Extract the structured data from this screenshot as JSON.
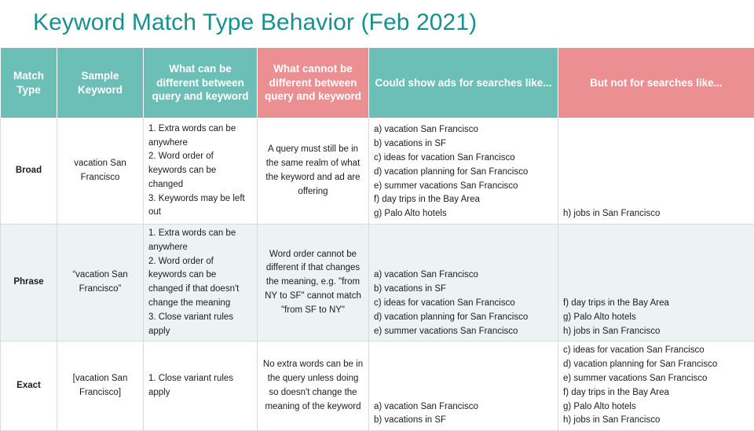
{
  "slide": {
    "title": "Keyword Match Type Behavior (Feb 2021)",
    "title_color": "#17918f",
    "background_color": "#ffffff"
  },
  "table": {
    "header_teal_color": "#6cbfb6",
    "header_salmon_color": "#eb8f92",
    "alt_row_color": "#ecf3f2",
    "columns": [
      {
        "label": "Match Type",
        "style": "teal"
      },
      {
        "label": "Sample Keyword",
        "style": "teal"
      },
      {
        "label": "What can be different between query and keyword",
        "style": "teal"
      },
      {
        "label": "What cannot be different between query and keyword",
        "style": "salmon"
      },
      {
        "label": "Could show ads for searches like...",
        "style": "teal"
      },
      {
        "label": "But not for searches like...",
        "style": "salmon"
      }
    ],
    "rows": [
      {
        "match_type": "Broad",
        "sample_keyword": "vacation San Francisco",
        "can_be_different": [
          "1. Extra words can be anywhere",
          "2. Word order of keywords can be changed",
          "3. Keywords may be left out"
        ],
        "cannot_be_different": [
          "A query must still be in the same realm of what the keyword and ad are offering"
        ],
        "could_show": [
          "a) vacation San Francisco",
          "b) vacations in SF",
          "c) ideas for vacation San Francisco",
          "d) vacation planning for San Francisco",
          "e) summer vacations San Francisco",
          "f) day trips in the Bay Area",
          "g) Palo Alto hotels"
        ],
        "but_not": [
          "h) jobs in San Francisco"
        ]
      },
      {
        "match_type": "Phrase",
        "sample_keyword": "“vacation San Francisco”",
        "can_be_different": [
          "1. Extra words can be anywhere",
          "2. Word order of keywords can be changed if that doesn't change the meaning",
          "3. Close variant rules apply"
        ],
        "cannot_be_different": [
          "Word order cannot be different if that changes the meaning, e.g. \"from NY to SF\" cannot match \"from SF to NY\""
        ],
        "could_show": [
          "a) vacation San Francisco",
          "b) vacations in SF",
          "c) ideas for vacation San Francisco",
          "d) vacation planning for San Francisco",
          "e) summer vacations San Francisco"
        ],
        "but_not": [
          "f) day trips in the Bay Area",
          "g) Palo Alto hotels",
          "h) jobs in San Francisco"
        ]
      },
      {
        "match_type": "Exact",
        "sample_keyword": "[vacation San Francisco]",
        "can_be_different": [
          "1. Close variant rules apply"
        ],
        "cannot_be_different": [
          "No extra words can be in the query unless doing so doesn't change the meaning of the keyword"
        ],
        "could_show": [
          "a) vacation San Francisco",
          "b) vacations in SF"
        ],
        "but_not": [
          "c) ideas for vacation San Francisco",
          "d) vacation planning for San Francisco",
          "e) summer vacations San Francisco",
          "f) day trips in the Bay Area",
          "g) Palo Alto hotels",
          "h) jobs in San Francisco"
        ]
      }
    ]
  }
}
